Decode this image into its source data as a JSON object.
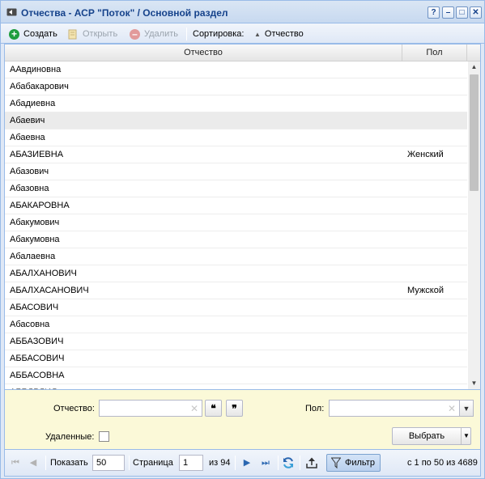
{
  "window": {
    "title": "Отчества - АСР \"Поток\" / Основной раздел",
    "tools": [
      "?",
      "–",
      "□",
      "✕"
    ]
  },
  "toolbar": {
    "create": "Создать",
    "open": "Открыть",
    "delete": "Удалить",
    "sort_label": "Сортировка:",
    "sort_field": "Отчество"
  },
  "grid": {
    "columns": [
      "Отчество",
      "Пол"
    ],
    "rows": [
      {
        "name": "ААвдиновна",
        "gender": ""
      },
      {
        "name": "Абабакарович",
        "gender": ""
      },
      {
        "name": "Абадиевна",
        "gender": ""
      },
      {
        "name": "Абаевич",
        "gender": ""
      },
      {
        "name": "Абаевна",
        "gender": ""
      },
      {
        "name": "АБАЗИЕВНА",
        "gender": "Женский"
      },
      {
        "name": "Абазович",
        "gender": ""
      },
      {
        "name": "Абазовна",
        "gender": ""
      },
      {
        "name": "АБАКАРОВНА",
        "gender": ""
      },
      {
        "name": "Абакумович",
        "gender": ""
      },
      {
        "name": "Абакумовна",
        "gender": ""
      },
      {
        "name": "Абалаевна",
        "gender": ""
      },
      {
        "name": "АБАЛХАНОВИЧ",
        "gender": ""
      },
      {
        "name": "АБАЛХАСАНОВИЧ",
        "gender": "Мужской"
      },
      {
        "name": "АБАСОВИЧ",
        "gender": ""
      },
      {
        "name": "Абасовна",
        "gender": ""
      },
      {
        "name": "АББАЗОВИЧ",
        "gender": ""
      },
      {
        "name": "АББАСОВИЧ",
        "gender": ""
      },
      {
        "name": "АББАСОВНА",
        "gender": ""
      },
      {
        "name": "АББДРЛИЛ",
        "gender": ""
      }
    ],
    "selected_index": 3
  },
  "filter": {
    "patronymic_label": "Отчество:",
    "patronymic_value": "",
    "quote_open": "❝",
    "quote_close": "❞",
    "gender_label": "Пол:",
    "gender_value": "",
    "deleted_label": "Удаленные:",
    "deleted_checked": false,
    "select_button": "Выбрать"
  },
  "pager": {
    "show_label": "Показать",
    "page_size": "50",
    "page_label": "Страница",
    "page": "1",
    "of_pages": "из 94",
    "filter_button": "Фильтр",
    "summary": "с 1 по 50 из 4689"
  },
  "colors": {
    "title_text": "#15428b",
    "border": "#99bbe8",
    "filter_bg": "#fbf9d8",
    "create_icon": "#1f9d3e",
    "delete_icon": "#e29a9a"
  }
}
